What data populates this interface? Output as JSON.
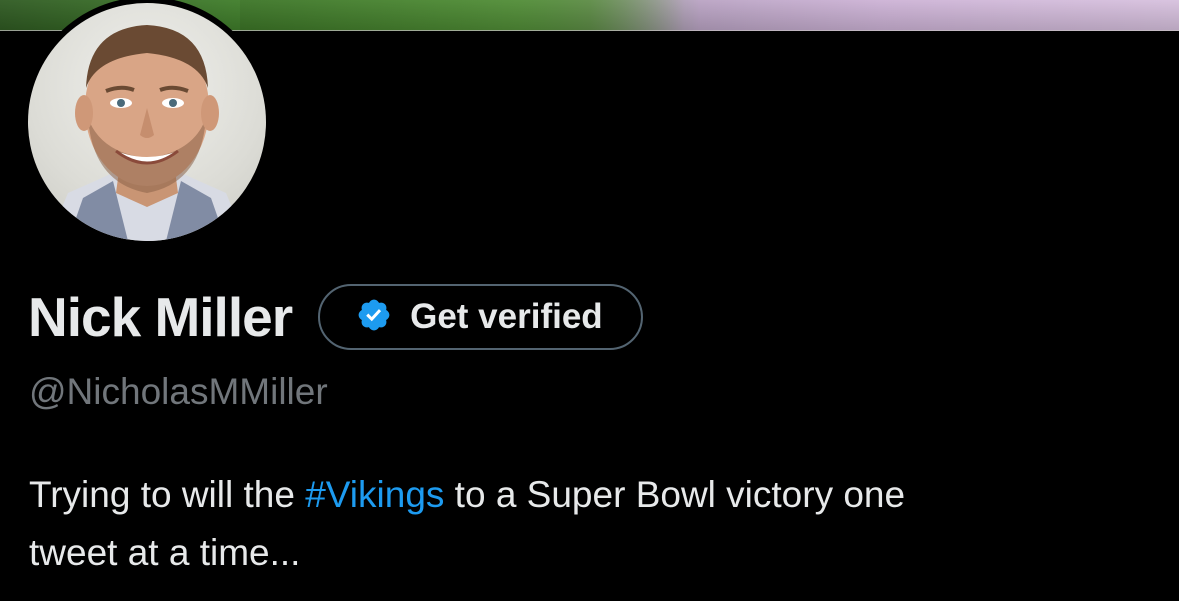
{
  "profile": {
    "display_name": "Nick Miller",
    "verify_button_label": "Get verified",
    "handle": "@NicholasMMiller",
    "bio": {
      "before": "Trying to will the ",
      "hashtag": "#Vikings",
      "after_line1": " to a Super Bowl victory one",
      "line2": "tweet at a time..."
    }
  },
  "colors": {
    "background": "#000000",
    "text_primary": "#e7e9ea",
    "text_secondary": "#71767b",
    "link": "#1d9bf0",
    "verified_badge": "#1d9bf0",
    "button_border": "#536471"
  },
  "icons": {
    "verified": "verified-badge-icon"
  }
}
